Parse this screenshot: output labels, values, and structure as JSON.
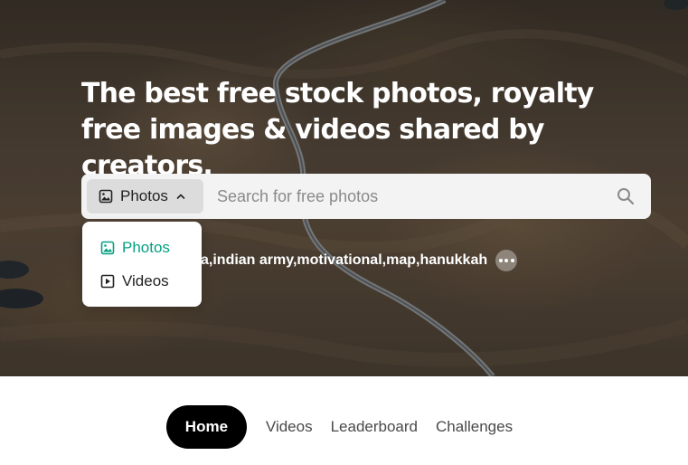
{
  "hero": {
    "headline": "The best free stock photos, royalty free images & videos shared by creators."
  },
  "search": {
    "type_selector": {
      "label": "Photos",
      "icon": "image-icon",
      "state": "expanded",
      "chevron": "chevron-up-icon"
    },
    "placeholder": "Search for free photos",
    "search_icon": "search-icon"
  },
  "dropdown": {
    "items": [
      {
        "label": "Photos",
        "icon": "image-icon",
        "selected": true
      },
      {
        "label": "Videos",
        "icon": "video-icon",
        "selected": false
      }
    ],
    "accent_color": "#05a081"
  },
  "suggestions": {
    "visible_text": [
      {
        "label": "a, "
      },
      {
        "label": "indian army, "
      },
      {
        "label": "motivational, "
      },
      {
        "label": "map, "
      },
      {
        "label": "hanukkah"
      }
    ],
    "more_icon": "more-horizontal-icon"
  },
  "nav": {
    "items": [
      {
        "label": "Home",
        "active": true
      },
      {
        "label": "Videos",
        "active": false
      },
      {
        "label": "Leaderboard",
        "active": false
      },
      {
        "label": "Challenges",
        "active": false
      }
    ]
  }
}
